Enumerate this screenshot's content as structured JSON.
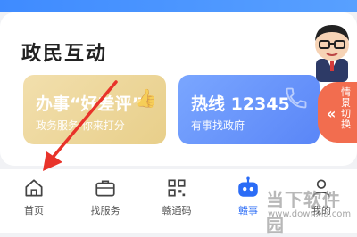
{
  "section": {
    "title": "政民互动"
  },
  "cards": [
    {
      "title": "办事“好差评”",
      "subtitle": "政务服务 你来打分"
    },
    {
      "title": "热线 12345",
      "subtitle": "有事找政府"
    }
  ],
  "side_tab": {
    "chevron": "«",
    "label": "情景切换"
  },
  "tabs": [
    {
      "label": "首页",
      "icon": "home-icon"
    },
    {
      "label": "找服务",
      "icon": "briefcase-icon"
    },
    {
      "label": "赣通码",
      "icon": "qr-code-icon"
    },
    {
      "label": "赣事",
      "icon": "robot-icon"
    },
    {
      "label": "我的",
      "icon": "user-icon"
    }
  ],
  "watermark": {
    "text": "当下软件园",
    "url": "www.downxia.com"
  },
  "colors": {
    "accent": "#2b6cf6",
    "annotation_arrow": "#e8332a",
    "side_tab": "#f26d4f"
  }
}
